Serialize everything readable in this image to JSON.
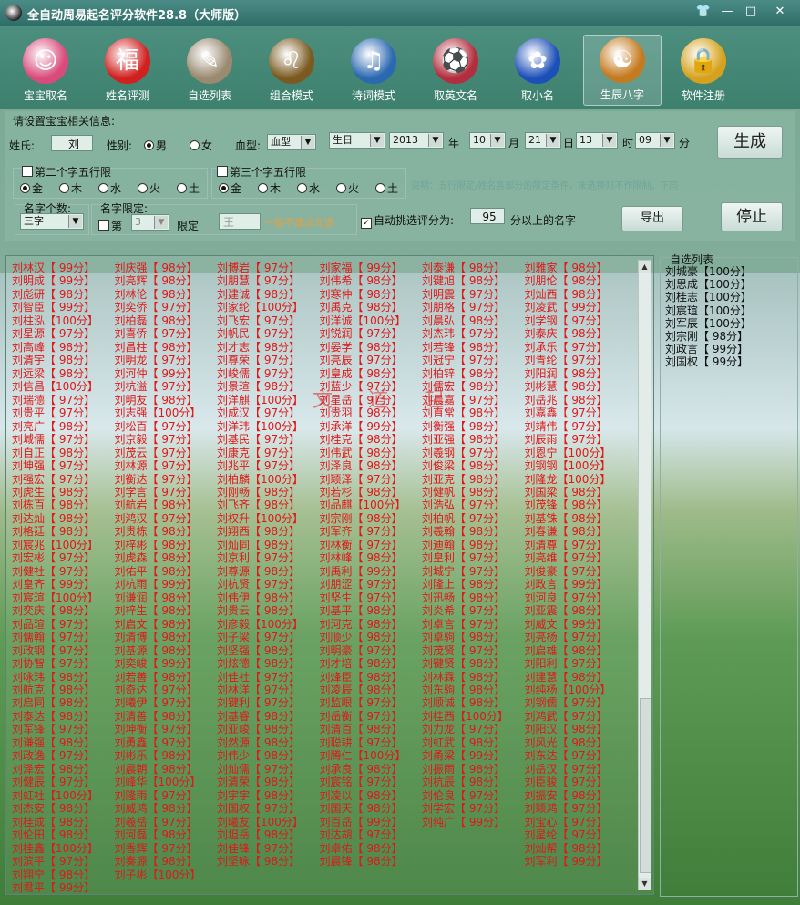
{
  "app": {
    "title": "全自动周易起名评分软件28.8（大师版）"
  },
  "window_controls": [
    "👕",
    "—",
    "□",
    "✕"
  ],
  "toolbar": [
    {
      "label": "宝宝取名",
      "icon": "baby-doll-icon",
      "color": "#d94b7a",
      "glyph": "☺"
    },
    {
      "label": "姓名评测",
      "icon": "fortune-bag-icon",
      "color": "#d12020",
      "glyph": "福"
    },
    {
      "label": "自选列表",
      "icon": "pencil-cup-icon",
      "color": "#9a8a70",
      "glyph": "✎"
    },
    {
      "label": "组合模式",
      "icon": "lion-icon",
      "color": "#7a5a20",
      "glyph": "♌"
    },
    {
      "label": "诗词模式",
      "icon": "book-disc-icon",
      "color": "#2a68b0",
      "glyph": "♫"
    },
    {
      "label": "取英文名",
      "icon": "barcelona-crest-icon",
      "color": "#b22d3d",
      "glyph": "⚽"
    },
    {
      "label": "取小名",
      "icon": "lotus-orb-icon",
      "color": "#1d4fb8",
      "glyph": "✿"
    },
    {
      "label": "生辰八字",
      "icon": "bagua-icon",
      "color": "#c47a1e",
      "glyph": "☯",
      "active": true
    },
    {
      "label": "软件注册",
      "icon": "padlock-icon",
      "color": "#d6a21e",
      "glyph": "🔒"
    }
  ],
  "settings": {
    "section_label": "请设置宝宝相关信息:",
    "surname_label": "姓氏:",
    "surname_value": "刘",
    "gender_label": "性别:",
    "male_label": "男",
    "female_label": "女",
    "blood_label": "血型:",
    "blood_value": "血型",
    "zodiac_value": "生日",
    "year_value": "2013",
    "year_label": "年",
    "month_value": "10",
    "month_label": "月",
    "day_value": "21",
    "day_label": "日",
    "hour_value": "13",
    "hour_label": "时",
    "minute_value": "09",
    "minute_label": "分",
    "generate_button": "生成",
    "second_char_label": "第二个字五行限",
    "third_char_label": "第三个字五行限",
    "elements": [
      "金",
      "木",
      "水",
      "火",
      "土"
    ],
    "note": "说明：五行限定/姓名各部分的限定条件，未选择则不作限制，下同",
    "count_label": "名字个数:",
    "count_value": "三字",
    "limit_label": "名字限定:",
    "limit_first": "第",
    "limit_pos": "3",
    "limit_word": "限定",
    "limit_char": "王",
    "limit_hint": "一般不建议勾选",
    "auto_label": "自动挑选评分为:",
    "auto_value": "95",
    "auto_suffix": "分以上的名字",
    "export_button": "导出",
    "stop_button": "停止"
  },
  "results": {
    "watermark": "文 道 起",
    "columns": [
      [
        "刘林汉【 99分】",
        "刘明成【 99分】",
        "刘彪研【 98分】",
        "刘智臣【 99分】",
        "刘柱泓【100分】",
        "刘星源【 97分】",
        "刘高峰【 98分】",
        "刘清宇【 98分】",
        "刘远梁【 98分】",
        "刘信昌【100分】",
        "刘瑞德【 97分】",
        "刘贵平【 97分】",
        "刘亮广【 98分】",
        "刘城儒【 97分】",
        "刘自正【 98分】",
        "刘坤强【 97分】",
        "刘强宏【 97分】",
        "刘虎生【 98分】",
        "刘栋百【 98分】",
        "刘达灿【 98分】",
        "刘格廷【 98分】",
        "刘宸兆【100分】",
        "刘宏彬【 97分】",
        "刘健社【 97分】",
        "刘皇齐【 99分】",
        "刘宸瑄【100分】",
        "刘奕庆【 98分】",
        "刘品瑄【 97分】",
        "刘儒翰【 97分】",
        "刘政钢【 97分】",
        "刘协智【 97分】",
        "刘咏玮【 98分】",
        "刘航克【 98分】",
        "刘启同【 98分】",
        "刘泰达【 98分】",
        "刘军锋【 97分】",
        "刘谦强【 98分】",
        "刘政逸【 97分】",
        "刘泽宏【 98分】",
        "刘健辰【 97分】",
        "刘虹社【100分】",
        "刘杰安【 98分】",
        "刘桂成【 98分】",
        "刘伦田【 98分】",
        "刘桂鑫【100分】",
        "刘滨平【 97分】",
        "刘翔宁【 98分】",
        "刘君平【 99分】"
      ],
      [
        "刘庆强【 98分】",
        "刘亮辉【 98分】",
        "刘林伦【 98分】",
        "刘奕侨【 97分】",
        "刘柏磊【 98分】",
        "刘喜侨【 97分】",
        "刘昌柱【 98分】",
        "刘明龙【 97分】",
        "刘河仲【 99分】",
        "刘杭溢【 97分】",
        "刘明友【 98分】",
        "刘志强【100分】",
        "刘松百【 97分】",
        "刘京毅【 97分】",
        "刘茂云【 97分】",
        "刘林源【 97分】",
        "刘衡达【 97分】",
        "刘学言【 97分】",
        "刘航岩【 98分】",
        "刘鸿汉【 97分】",
        "刘贵栋【 98分】",
        "刘梓彬【 98分】",
        "刘虎森【 98分】",
        "刘佑平【 98分】",
        "刘杭雨【 99分】",
        "刘谦润【 98分】",
        "刘梓生【 98分】",
        "刘启文【 98分】",
        "刘清博【 98分】",
        "刘基源【 98分】",
        "刘奕峻【 99分】",
        "刘若善【 98分】",
        "刘奇达【 97分】",
        "刘曦伊【 97分】",
        "刘清善【 98分】",
        "刘坤衡【 97分】",
        "刘勇鑫【 97分】",
        "刘彬乐【 98分】",
        "刘晨朝【 98分】",
        "刘峰华【100分】",
        "刘隆雨【 97分】",
        "刘威鸿【 98分】",
        "刘羲岳【 97分】",
        "刘河磊【 98分】",
        "刘香辉【 97分】",
        "刘奏源【 98分】",
        "刘子彬【100分】"
      ],
      [
        "刘博岩【 97分】",
        "刘朋慧【 97分】",
        "刘建诚【 98分】",
        "刘家纶【100分】",
        "刘飞宏【 97分】",
        "刘帆民【 97分】",
        "刘才志【 98分】",
        "刘尊荣【 97分】",
        "刘峻儒【 97分】",
        "刘景瑄【 98分】",
        "刘洋麒【100分】",
        "刘成汉【 97分】",
        "刘洋玮【100分】",
        "刘基民【 97分】",
        "刘康克【 97分】",
        "刘兆平【 97分】",
        "刘柏麟【100分】",
        "刘刚畅【 98分】",
        "刘飞齐【 98分】",
        "刘权升【100分】",
        "刘翔西【 98分】",
        "刘灿同【 98分】",
        "刘京利【 97分】",
        "刘尊源【 98分】",
        "刘杭贤【 97分】",
        "刘伟伊【 98分】",
        "刘贵云【 98分】",
        "刘彦毅【100分】",
        "刘子梁【 97分】",
        "刘坚强【 98分】",
        "刘炫德【 98分】",
        "刘佳社【 97分】",
        "刘林洋【 97分】",
        "刘键利【 97分】",
        "刘基睿【 98分】",
        "刘亚峻【 98分】",
        "刘然源【 98分】",
        "刘伟少【 98分】",
        "刘灿儒【 97分】",
        "刘清荣【 98分】",
        "刘宇宇【 98分】",
        "刘国权【 97分】",
        "刘曦友【100分】",
        "刘坦岳【 98分】",
        "刘佳锋【 97分】",
        "刘坚咏【 98分】"
      ],
      [
        "刘家福【 99分】",
        "刘伟希【 98分】",
        "刘寒仲【 98分】",
        "刘禹克【 98分】",
        "刘洋诚【100分】",
        "刘锐润【 97分】",
        "刘晏学【 98分】",
        "刘亮辰【 97分】",
        "刘皇成【 98分】",
        "刘蓝少【 97分】",
        "刘星岳【 97分】",
        "刘贵羽【 98分】",
        "刘承洋【 99分】",
        "刘桂克【 98分】",
        "刘伟武【 98分】",
        "刘泽良【 98分】",
        "刘颖泽【 97分】",
        "刘若杉【 98分】",
        "刘品麒【100分】",
        "刘宗刚【 98分】",
        "刘军齐【 97分】",
        "刘林衡【 97分】",
        "刘林峰【 98分】",
        "刘禹利【 99分】",
        "刘朋涩【 97分】",
        "刘坚生【 97分】",
        "刘基平【 98分】",
        "刘河克【 98分】",
        "刘顺少【 98分】",
        "刘明豪【 97分】",
        "刘才培【 98分】",
        "刘烽臣【 98分】",
        "刘凌辰【 98分】",
        "刘监眼【 97分】",
        "刘岳衡【 97分】",
        "刘清百【 98分】",
        "刘聪耕【 97分】",
        "刘腾仁【100分】",
        "刘承良【 98分】",
        "刘宸铭【 97分】",
        "刘凌以【 98分】",
        "刘国天【 98分】",
        "刘百岳【 99分】",
        "刘达胡【 97分】",
        "刘卓佑【 98分】",
        "刘晨锋【 98分】"
      ],
      [
        "刘泰谦【 98分】",
        "刘键旭【 98分】",
        "刘明震【 97分】",
        "刘朋格【 97分】",
        "刘晨弘【 98分】",
        "刘杰玮【 97分】",
        "刘若锋【 98分】",
        "刘冠宁【 97分】",
        "刘柏锌【 98分】",
        "刘儒宏【 98分】",
        "刘晨嘉【 97分】",
        "刘直常【 98分】",
        "刘衡强【 98分】",
        "刘亚强【 98分】",
        "刘羲钢【 97分】",
        "刘俊梁【 98分】",
        "刘亚克【 98分】",
        "刘健帆【 98分】",
        "刘浩弘【 97分】",
        "刘柏帆【 97分】",
        "刘羲翰【 98分】",
        "刘迪翰【 98分】",
        "刘皇利【 97分】",
        "刘城宁【 97分】",
        "刘隆上【 98分】",
        "刘迅畅【 98分】",
        "刘炎希【 97分】",
        "刘卓言【 97分】",
        "刘卓驹【 98分】",
        "刘茂贤【 97分】",
        "刘键贤【 98分】",
        "刘林霖【 98分】",
        "刘东驹【 98分】",
        "刘顺诚【 98分】",
        "刘桂西【100分】",
        "刘力龙【 97分】",
        "刘虹武【 98分】",
        "刘甬梁【 99分】",
        "刘振雨【 98分】",
        "刘杭辰【 98分】",
        "刘伦良【 97分】",
        "刘学宏【 97分】",
        "刘纯广【 99分】"
      ],
      [
        "刘雅家【 98分】",
        "刘朋伦【 98分】",
        "刘灿西【 98分】",
        "刘凌武【 99分】",
        "刘学钢【 97分】",
        "刘泰庆【 98分】",
        "刘承乐【 97分】",
        "刘青纶【 97分】",
        "刘阳润【 98分】",
        "刘彬慧【 98分】",
        "刘岳兆【 98分】",
        "刘嘉鑫【 97分】",
        "刘靖伟【 97分】",
        "刘辰雨【 97分】",
        "刘恩宁【100分】",
        "刘钢钢【100分】",
        "刘隆龙【100分】",
        "刘国梁【 98分】",
        "刘茂锋【 98分】",
        "刘基铢【 98分】",
        "刘春谦【 98分】",
        "刘清尊【 97分】",
        "刘亮维【 97分】",
        "刘俊豪【 97分】",
        "刘政言【 99分】",
        "刘河良【 97分】",
        "刘亚震【 98分】",
        "刘威文【 99分】",
        "刘亮杨【 97分】",
        "刘启雄【 98分】",
        "刘阳利【 97分】",
        "刘建慧【 98分】",
        "刘纯杨【100分】",
        "刘钢儒【 97分】",
        "刘鸿武【 97分】",
        "刘阳汉【 98分】",
        "刘风光【 98分】",
        "刘东达【 97分】",
        "刘岳汉【 97分】",
        "刘臣骏【 97分】",
        "刘振安【 98分】",
        "刘颖鸿【 97分】",
        "刘宝心【 97分】",
        "刘星纶【 97分】",
        "刘灿帮【 98分】",
        "刘军利【 99分】"
      ]
    ]
  },
  "favorites": {
    "title": "自选列表",
    "items": [
      "刘城豪【100分】",
      "刘思成【100分】",
      "刘桂志【100分】",
      "刘宸瑄【100分】",
      "刘军辰【100分】",
      "刘宗刚【 98分】",
      "刘政言【 99分】",
      "刘国权【 99分】"
    ]
  }
}
